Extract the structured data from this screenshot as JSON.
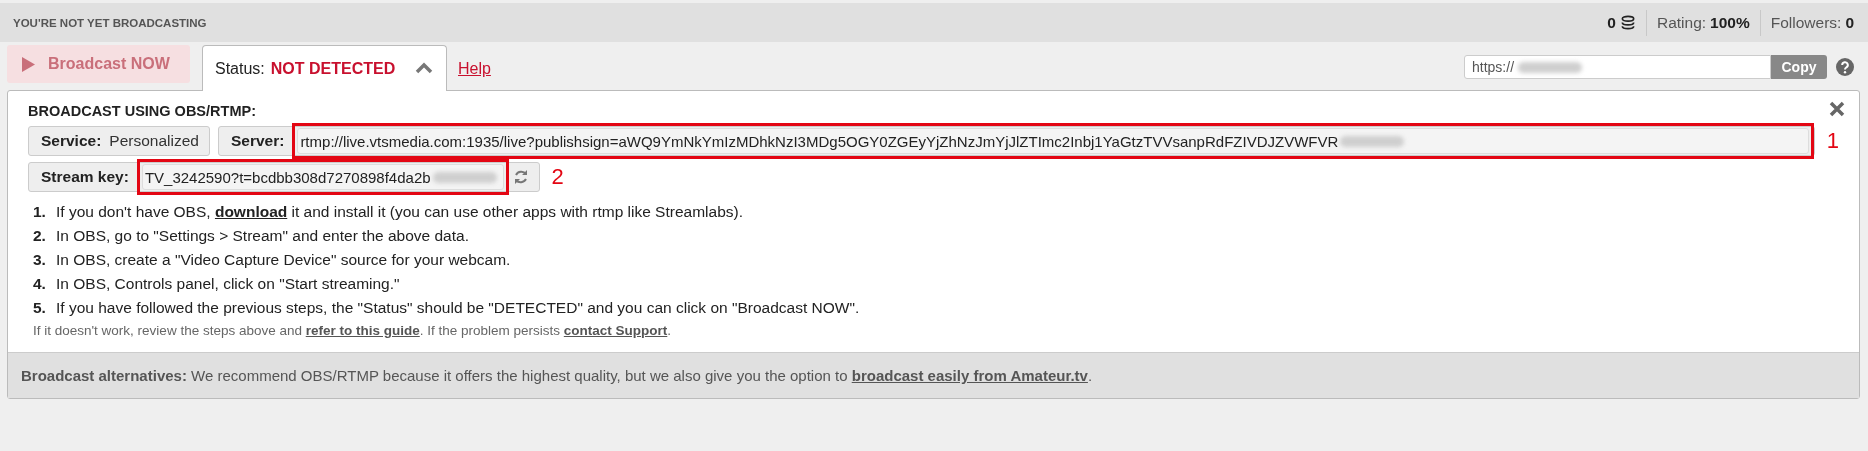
{
  "header": {
    "title": "YOU'RE NOT YET BROADCASTING",
    "coins": "0",
    "rating_label": "Rating:",
    "rating": "100%",
    "followers_label": "Followers:",
    "followers": "0"
  },
  "toolbar": {
    "broadcast_button": {
      "label": "Broadcast NOW",
      "disabled": true
    },
    "status_tab": {
      "label": "Status:",
      "value": "NOT DETECTED",
      "expanded": true
    },
    "help_link": "Help",
    "share_url": {
      "value": "https://",
      "blurred": true
    },
    "copy_button": "Copy"
  },
  "panel": {
    "title": "BROADCAST USING OBS/RTMP:",
    "service": {
      "label": "Service:",
      "value": "Personalized"
    },
    "server": {
      "label": "Server:",
      "value": "rtmp://live.vtsmedia.com:1935/live?publishsign=aWQ9YmNkYmIzMDhkNzI3MDg5OGY0ZGEyYjZhNzJmYjJlZTImc2Inbj1YaGtzTVVsanpRdFZIVDJZVWFVR",
      "blurred": true,
      "annotation": "1"
    },
    "stream_key": {
      "label": "Stream key:",
      "value": "TV_3242590?t=bcdbb308d7270898f4da2b",
      "blurred": true,
      "annotation": "2"
    },
    "steps": [
      {
        "number": "1.",
        "segments": [
          {
            "kind": "text",
            "text": "If you don't have OBS, "
          },
          {
            "kind": "link",
            "text": "download"
          },
          {
            "kind": "text",
            "text": " it and install it (you can use other apps with rtmp like Streamlabs)."
          }
        ]
      },
      {
        "number": "2.",
        "segments": [
          {
            "kind": "text",
            "text": "In OBS, go to \"Settings > Stream\" and enter the above data."
          }
        ]
      },
      {
        "number": "3.",
        "segments": [
          {
            "kind": "text",
            "text": "In OBS, create a \"Video Capture Device\" source for your webcam."
          }
        ]
      },
      {
        "number": "4.",
        "segments": [
          {
            "kind": "text",
            "text": "In OBS, Controls panel, click on \"Start streaming.\""
          }
        ]
      },
      {
        "number": "5.",
        "segments": [
          {
            "kind": "text",
            "text": "If you have followed the previous steps, the \"Status\" should be \"DETECTED\" and you can click on \"Broadcast NOW\"."
          }
        ]
      }
    ],
    "note": [
      {
        "kind": "text",
        "text": "If it doesn't work, review the steps above and "
      },
      {
        "kind": "link",
        "text": "refer to this guide"
      },
      {
        "kind": "text",
        "text": ". If the problem persists "
      },
      {
        "kind": "link",
        "text": "contact Support"
      },
      {
        "kind": "text",
        "text": "."
      }
    ]
  },
  "alternatives": [
    {
      "kind": "text",
      "text": "**Broadcast alternatives:** We recommend OBS/RTMP because it offers the highest quality, but we also give you the option to "
    },
    {
      "kind": "link",
      "text": "broadcast easily from Amateur.tv"
    },
    {
      "kind": "text",
      "text": "."
    }
  ]
}
